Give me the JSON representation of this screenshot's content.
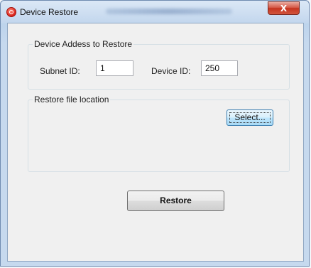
{
  "window": {
    "title": "Device Restore",
    "close_glyph": "X"
  },
  "group_device": {
    "legend": "Device Addess to Restore",
    "subnet_label": "Subnet ID:",
    "subnet_value": "1",
    "device_label": "Device ID:",
    "device_value": "250"
  },
  "group_file": {
    "legend": "Restore file location",
    "select_label": "Select..."
  },
  "restore_label": "Restore",
  "icons": {
    "app": "app-logo-icon",
    "close": "close-icon"
  },
  "colors": {
    "close_button": "#c5341f",
    "focused_button_border": "#3c7fb1"
  }
}
